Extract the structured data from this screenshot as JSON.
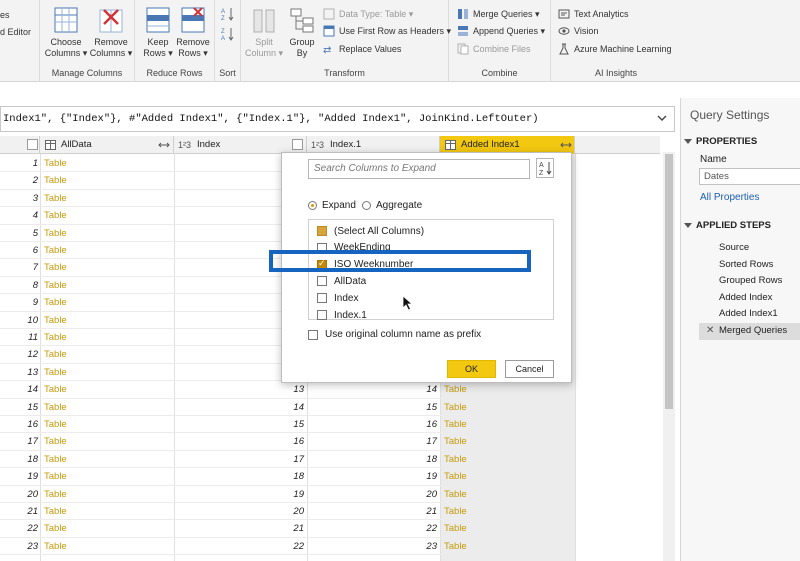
{
  "ribbon": {
    "partial_left_top": "es",
    "partial_left_bottom": "d Editor",
    "manage_columns": {
      "label": "Manage Columns",
      "choose_columns": [
        "Choose",
        "Columns ▾"
      ],
      "remove_columns": [
        "Remove",
        "Columns ▾"
      ]
    },
    "reduce_rows": {
      "label": "Reduce Rows",
      "keep_rows": [
        "Keep",
        "Rows ▾"
      ],
      "remove_rows": [
        "Remove",
        "Rows ▾"
      ]
    },
    "sort": {
      "label": "Sort"
    },
    "transform": {
      "label": "Transform",
      "split_column": [
        "Split",
        "Column ▾"
      ],
      "group_by": [
        "Group",
        "By"
      ],
      "data_type": "Data Type: Table ▾",
      "use_first_row": "Use First Row as Headers ▾",
      "replace_values": "Replace Values"
    },
    "combine": {
      "label": "Combine",
      "merge_queries": "Merge Queries ▾",
      "append_queries": "Append Queries ▾",
      "combine_files": "Combine Files"
    },
    "ai_insights": {
      "label": "AI Insights",
      "text_analytics": "Text Analytics",
      "vision": "Vision",
      "azure_ml": "Azure Machine Learning"
    }
  },
  "formula": {
    "text_before": "Index1\", {\"Index\"}, #\"Added Index1\", {\"Index.1\"}, \"Added Index1\", JoinKind.LeftOuter)"
  },
  "grid": {
    "headers": {
      "alldata": "AllData",
      "index_type": "1²3",
      "index": "Index",
      "index1_type": "1²3",
      "index1": "Index.1",
      "added": "Added Index1"
    },
    "table_word": "Table",
    "rows": [
      {
        "n": 1,
        "idx": "",
        "idx1": "",
        "added": ""
      },
      {
        "n": 2,
        "idx": "",
        "idx1": "",
        "added": ""
      },
      {
        "n": 3,
        "idx": "",
        "idx1": "",
        "added": ""
      },
      {
        "n": 4,
        "idx": "",
        "idx1": "",
        "added": ""
      },
      {
        "n": 5,
        "idx": "",
        "idx1": "",
        "added": ""
      },
      {
        "n": 6,
        "idx": "",
        "idx1": "",
        "added": ""
      },
      {
        "n": 7,
        "idx": "",
        "idx1": "",
        "added": ""
      },
      {
        "n": 8,
        "idx": "",
        "idx1": "",
        "added": ""
      },
      {
        "n": 9,
        "idx": "",
        "idx1": "",
        "added": ""
      },
      {
        "n": 10,
        "idx": "",
        "idx1": "",
        "added": ""
      },
      {
        "n": 11,
        "idx": "",
        "idx1": "",
        "added": ""
      },
      {
        "n": 12,
        "idx": "",
        "idx1": "",
        "added": ""
      },
      {
        "n": 13,
        "idx": "",
        "idx1": "",
        "added": ""
      },
      {
        "n": 14,
        "idx": "13",
        "idx1": "14",
        "added": "Table"
      },
      {
        "n": 15,
        "idx": "14",
        "idx1": "15",
        "added": "Table"
      },
      {
        "n": 16,
        "idx": "15",
        "idx1": "16",
        "added": "Table"
      },
      {
        "n": 17,
        "idx": "16",
        "idx1": "17",
        "added": "Table"
      },
      {
        "n": 18,
        "idx": "17",
        "idx1": "18",
        "added": "Table"
      },
      {
        "n": 19,
        "idx": "18",
        "idx1": "19",
        "added": "Table"
      },
      {
        "n": 20,
        "idx": "19",
        "idx1": "20",
        "added": "Table"
      },
      {
        "n": 21,
        "idx": "20",
        "idx1": "21",
        "added": "Table"
      },
      {
        "n": 22,
        "idx": "21",
        "idx1": "22",
        "added": "Table"
      },
      {
        "n": 23,
        "idx": "22",
        "idx1": "23",
        "added": "Table"
      }
    ]
  },
  "expand_dialog": {
    "search_placeholder": "Search Columns to Expand",
    "expand_label": "Expand",
    "aggregate_label": "Aggregate",
    "columns": [
      {
        "label": "(Select All Columns)",
        "state": "partial"
      },
      {
        "label": "WeekEnding",
        "state": "unchecked"
      },
      {
        "label": "ISO Weeknumber",
        "state": "checked"
      },
      {
        "label": "AllData",
        "state": "unchecked"
      },
      {
        "label": "Index",
        "state": "unchecked"
      },
      {
        "label": "Index.1",
        "state": "unchecked"
      }
    ],
    "prefix_label": "Use original column name as prefix",
    "ok_label": "OK",
    "cancel_label": "Cancel",
    "highlight_color": "#1565c0"
  },
  "query_settings": {
    "title": "Query Settings",
    "properties_header": "PROPERTIES",
    "name_label": "Name",
    "name_value": "Dates",
    "all_properties": "All Properties",
    "applied_steps_header": "APPLIED STEPS",
    "steps": [
      "Source",
      "Sorted Rows",
      "Grouped Rows",
      "Added Index",
      "Added Index1",
      "Merged Queries"
    ],
    "active_step_index": 5
  },
  "colors": {
    "accent_yellow": "#f2c811",
    "table_link": "#c59b0a",
    "link_blue": "#1a5fb4"
  }
}
